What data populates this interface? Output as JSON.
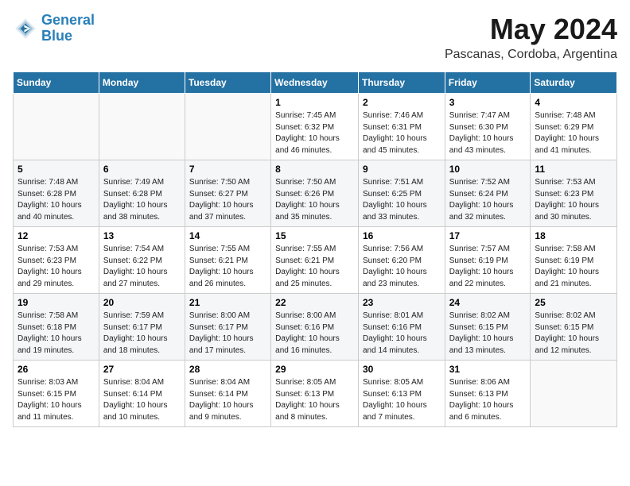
{
  "header": {
    "logo_line1": "General",
    "logo_line2": "Blue",
    "title": "May 2024",
    "subtitle": "Pascanas, Cordoba, Argentina"
  },
  "weekdays": [
    "Sunday",
    "Monday",
    "Tuesday",
    "Wednesday",
    "Thursday",
    "Friday",
    "Saturday"
  ],
  "weeks": [
    [
      {
        "day": "",
        "info": ""
      },
      {
        "day": "",
        "info": ""
      },
      {
        "day": "",
        "info": ""
      },
      {
        "day": "1",
        "info": "Sunrise: 7:45 AM\nSunset: 6:32 PM\nDaylight: 10 hours\nand 46 minutes."
      },
      {
        "day": "2",
        "info": "Sunrise: 7:46 AM\nSunset: 6:31 PM\nDaylight: 10 hours\nand 45 minutes."
      },
      {
        "day": "3",
        "info": "Sunrise: 7:47 AM\nSunset: 6:30 PM\nDaylight: 10 hours\nand 43 minutes."
      },
      {
        "day": "4",
        "info": "Sunrise: 7:48 AM\nSunset: 6:29 PM\nDaylight: 10 hours\nand 41 minutes."
      }
    ],
    [
      {
        "day": "5",
        "info": "Sunrise: 7:48 AM\nSunset: 6:28 PM\nDaylight: 10 hours\nand 40 minutes."
      },
      {
        "day": "6",
        "info": "Sunrise: 7:49 AM\nSunset: 6:28 PM\nDaylight: 10 hours\nand 38 minutes."
      },
      {
        "day": "7",
        "info": "Sunrise: 7:50 AM\nSunset: 6:27 PM\nDaylight: 10 hours\nand 37 minutes."
      },
      {
        "day": "8",
        "info": "Sunrise: 7:50 AM\nSunset: 6:26 PM\nDaylight: 10 hours\nand 35 minutes."
      },
      {
        "day": "9",
        "info": "Sunrise: 7:51 AM\nSunset: 6:25 PM\nDaylight: 10 hours\nand 33 minutes."
      },
      {
        "day": "10",
        "info": "Sunrise: 7:52 AM\nSunset: 6:24 PM\nDaylight: 10 hours\nand 32 minutes."
      },
      {
        "day": "11",
        "info": "Sunrise: 7:53 AM\nSunset: 6:23 PM\nDaylight: 10 hours\nand 30 minutes."
      }
    ],
    [
      {
        "day": "12",
        "info": "Sunrise: 7:53 AM\nSunset: 6:23 PM\nDaylight: 10 hours\nand 29 minutes."
      },
      {
        "day": "13",
        "info": "Sunrise: 7:54 AM\nSunset: 6:22 PM\nDaylight: 10 hours\nand 27 minutes."
      },
      {
        "day": "14",
        "info": "Sunrise: 7:55 AM\nSunset: 6:21 PM\nDaylight: 10 hours\nand 26 minutes."
      },
      {
        "day": "15",
        "info": "Sunrise: 7:55 AM\nSunset: 6:21 PM\nDaylight: 10 hours\nand 25 minutes."
      },
      {
        "day": "16",
        "info": "Sunrise: 7:56 AM\nSunset: 6:20 PM\nDaylight: 10 hours\nand 23 minutes."
      },
      {
        "day": "17",
        "info": "Sunrise: 7:57 AM\nSunset: 6:19 PM\nDaylight: 10 hours\nand 22 minutes."
      },
      {
        "day": "18",
        "info": "Sunrise: 7:58 AM\nSunset: 6:19 PM\nDaylight: 10 hours\nand 21 minutes."
      }
    ],
    [
      {
        "day": "19",
        "info": "Sunrise: 7:58 AM\nSunset: 6:18 PM\nDaylight: 10 hours\nand 19 minutes."
      },
      {
        "day": "20",
        "info": "Sunrise: 7:59 AM\nSunset: 6:17 PM\nDaylight: 10 hours\nand 18 minutes."
      },
      {
        "day": "21",
        "info": "Sunrise: 8:00 AM\nSunset: 6:17 PM\nDaylight: 10 hours\nand 17 minutes."
      },
      {
        "day": "22",
        "info": "Sunrise: 8:00 AM\nSunset: 6:16 PM\nDaylight: 10 hours\nand 16 minutes."
      },
      {
        "day": "23",
        "info": "Sunrise: 8:01 AM\nSunset: 6:16 PM\nDaylight: 10 hours\nand 14 minutes."
      },
      {
        "day": "24",
        "info": "Sunrise: 8:02 AM\nSunset: 6:15 PM\nDaylight: 10 hours\nand 13 minutes."
      },
      {
        "day": "25",
        "info": "Sunrise: 8:02 AM\nSunset: 6:15 PM\nDaylight: 10 hours\nand 12 minutes."
      }
    ],
    [
      {
        "day": "26",
        "info": "Sunrise: 8:03 AM\nSunset: 6:15 PM\nDaylight: 10 hours\nand 11 minutes."
      },
      {
        "day": "27",
        "info": "Sunrise: 8:04 AM\nSunset: 6:14 PM\nDaylight: 10 hours\nand 10 minutes."
      },
      {
        "day": "28",
        "info": "Sunrise: 8:04 AM\nSunset: 6:14 PM\nDaylight: 10 hours\nand 9 minutes."
      },
      {
        "day": "29",
        "info": "Sunrise: 8:05 AM\nSunset: 6:13 PM\nDaylight: 10 hours\nand 8 minutes."
      },
      {
        "day": "30",
        "info": "Sunrise: 8:05 AM\nSunset: 6:13 PM\nDaylight: 10 hours\nand 7 minutes."
      },
      {
        "day": "31",
        "info": "Sunrise: 8:06 AM\nSunset: 6:13 PM\nDaylight: 10 hours\nand 6 minutes."
      },
      {
        "day": "",
        "info": ""
      }
    ]
  ]
}
